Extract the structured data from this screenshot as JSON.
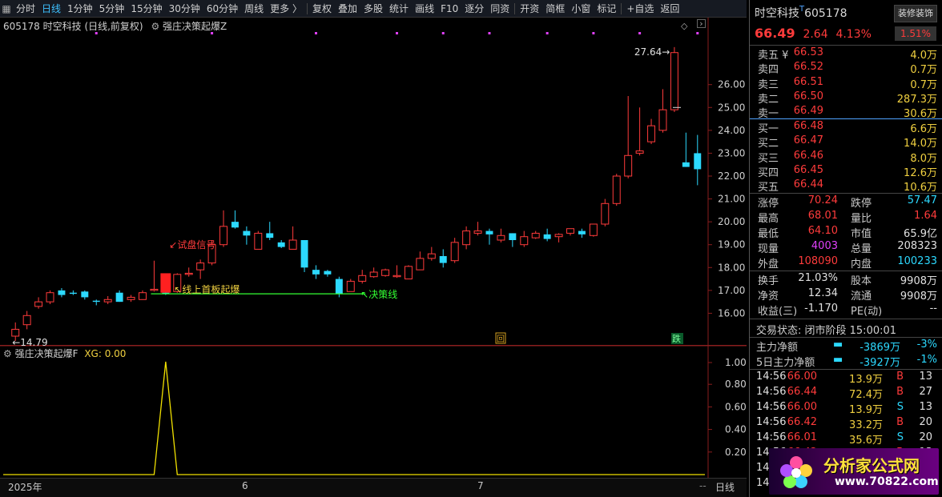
{
  "toolbar": {
    "items": [
      "分时",
      "日线",
      "1分钟",
      "5分钟",
      "15分钟",
      "30分钟",
      "60分钟",
      "周线",
      "更多 〉",
      "复权",
      "叠加",
      "多股",
      "统计",
      "画线",
      "F10",
      "逐分",
      "同资",
      "开资",
      "简框",
      "小窗",
      "标记",
      "+自选",
      "返回"
    ],
    "active": "日线"
  },
  "chart": {
    "header_title": "605178 时空科技 (日线,前复权)",
    "indicator_name": "强庄决策起爆Z",
    "y_ticks": [
      "26.00",
      "25.00",
      "24.00",
      "23.00",
      "22.00",
      "21.00",
      "20.00",
      "19.00",
      "18.00",
      "17.00",
      "16.00"
    ],
    "y_min": 15.0,
    "y_max": 28.3,
    "high_label": "27.64",
    "low_label": "14.79",
    "annotations": {
      "trial_pan": "试盘信号",
      "first_board": "线上首板起爆",
      "decision_line": "决策线"
    },
    "decision_line_price": 16.85,
    "markers": {
      "box_icon": "回",
      "fall_icon": "跌"
    },
    "colors": {
      "up": "#ff3b3b",
      "down": "#2cd9ff",
      "decision": "#33ff33",
      "annot_red": "#ff3b3b",
      "annot_yellow": "#f0d040",
      "purple_dot": "#e040fb"
    },
    "candles": [
      [
        15.0,
        15.6,
        14.79,
        15.3
      ],
      [
        15.5,
        16.1,
        15.3,
        15.9
      ],
      [
        16.3,
        16.7,
        16.2,
        16.5
      ],
      [
        16.5,
        17.0,
        16.4,
        16.9
      ],
      [
        17.0,
        17.1,
        16.7,
        16.8
      ],
      [
        16.9,
        17.0,
        16.8,
        16.85
      ],
      [
        16.95,
        17.0,
        16.6,
        16.7
      ],
      [
        16.55,
        16.6,
        16.35,
        16.5
      ],
      [
        16.5,
        16.75,
        16.4,
        16.6
      ],
      [
        16.9,
        17.0,
        16.5,
        16.5
      ],
      [
        16.6,
        16.8,
        16.5,
        16.7
      ],
      [
        16.6,
        17.0,
        16.6,
        16.9
      ],
      [
        17.0,
        18.3,
        16.95,
        17.05
      ],
      [
        16.9,
        17.0,
        16.8,
        16.85
      ],
      [
        16.95,
        17.75,
        16.9,
        17.7
      ],
      [
        17.7,
        18.0,
        17.6,
        17.75
      ],
      [
        17.9,
        18.35,
        17.5,
        18.2
      ],
      [
        18.2,
        19.2,
        18.1,
        19.0
      ],
      [
        19.0,
        20.5,
        18.9,
        19.8
      ],
      [
        20.0,
        20.5,
        19.7,
        19.75
      ],
      [
        19.6,
        19.8,
        19.0,
        19.4
      ],
      [
        18.8,
        19.6,
        18.8,
        19.5
      ],
      [
        19.5,
        20.0,
        19.2,
        19.3
      ],
      [
        19.1,
        19.2,
        18.85,
        18.9
      ],
      [
        18.8,
        19.8,
        18.8,
        19.2
      ],
      [
        19.2,
        19.2,
        17.8,
        18.0
      ],
      [
        17.9,
        18.1,
        17.5,
        17.7
      ],
      [
        17.85,
        17.9,
        17.6,
        17.7
      ],
      [
        17.5,
        17.6,
        16.7,
        16.85
      ],
      [
        16.95,
        17.5,
        16.95,
        17.4
      ],
      [
        17.4,
        17.9,
        17.3,
        17.65
      ],
      [
        17.6,
        18.0,
        17.55,
        17.8
      ],
      [
        17.65,
        17.95,
        17.6,
        17.9
      ],
      [
        17.6,
        18.1,
        17.55,
        17.65
      ],
      [
        17.5,
        18.1,
        17.5,
        18.05
      ],
      [
        17.9,
        18.7,
        17.9,
        18.4
      ],
      [
        18.4,
        18.9,
        18.3,
        18.6
      ],
      [
        18.5,
        18.8,
        18.0,
        18.2
      ],
      [
        18.3,
        19.3,
        18.2,
        19.1
      ],
      [
        19.0,
        19.8,
        18.8,
        19.6
      ],
      [
        19.5,
        20.0,
        19.4,
        19.6
      ],
      [
        19.6,
        19.7,
        19.0,
        19.45
      ],
      [
        19.2,
        19.7,
        19.1,
        19.4
      ],
      [
        19.5,
        19.5,
        18.9,
        19.2
      ],
      [
        19.0,
        19.6,
        18.9,
        19.35
      ],
      [
        19.3,
        19.6,
        19.25,
        19.5
      ],
      [
        19.45,
        19.7,
        19.15,
        19.25
      ],
      [
        19.35,
        19.5,
        19.1,
        19.45
      ],
      [
        19.5,
        19.7,
        19.4,
        19.7
      ],
      [
        19.6,
        19.7,
        19.3,
        19.45
      ],
      [
        19.4,
        19.9,
        19.35,
        19.9
      ],
      [
        19.9,
        21.0,
        19.8,
        20.8
      ],
      [
        20.8,
        22.1,
        20.7,
        22.0
      ],
      [
        22.0,
        25.5,
        21.9,
        22.9
      ],
      [
        23.0,
        25.0,
        22.9,
        23.1
      ],
      [
        23.5,
        24.5,
        23.4,
        24.2
      ],
      [
        24.0,
        25.8,
        23.9,
        24.9
      ],
      [
        24.9,
        27.64,
        24.8,
        27.4
      ],
      [
        22.6,
        23.9,
        22.4,
        22.4
      ],
      [
        23.0,
        23.8,
        21.6,
        22.3
      ]
    ],
    "date_labels": [
      "2025年",
      "6",
      "7"
    ]
  },
  "indicator": {
    "header": "强庄决策起爆F",
    "xg_label": "XG: 0.00",
    "y_ticks": [
      "1.00",
      "0.80",
      "0.60",
      "0.40",
      "0.20"
    ],
    "spike_index": 13
  },
  "side": {
    "name": "时空科技",
    "superscript": "T",
    "code": "605178",
    "decorate": "装修装饰",
    "price": "66.49",
    "change": "2.64",
    "change_pct": "4.13%",
    "badge": "1.51%",
    "asks": [
      {
        "label": "卖五 ¥",
        "price": "66.53",
        "vol": "4.0万"
      },
      {
        "label": "卖四",
        "price": "66.52",
        "vol": "0.7万"
      },
      {
        "label": "卖三",
        "price": "66.51",
        "vol": "0.7万"
      },
      {
        "label": "卖二",
        "price": "66.50",
        "vol": "287.3万"
      },
      {
        "label": "卖一",
        "price": "66.49",
        "vol": "30.6万"
      }
    ],
    "bids": [
      {
        "label": "买一",
        "price": "66.48",
        "vol": "6.6万"
      },
      {
        "label": "买二",
        "price": "66.47",
        "vol": "14.0万"
      },
      {
        "label": "买三",
        "price": "66.46",
        "vol": "8.0万"
      },
      {
        "label": "买四",
        "price": "66.45",
        "vol": "12.6万"
      },
      {
        "label": "买五",
        "price": "66.44",
        "vol": "10.6万"
      }
    ],
    "stats": [
      {
        "l1": "涨停",
        "v1": "70.24",
        "c1": "red",
        "l2": "跌停",
        "v2": "57.47",
        "c2": "cyan"
      },
      {
        "l1": "最高",
        "v1": "68.01",
        "c1": "red",
        "l2": "量比",
        "v2": "1.64",
        "c2": "red"
      },
      {
        "l1": "最低",
        "v1": "64.10",
        "c1": "red",
        "l2": "市值",
        "v2": "65.9亿",
        "c2": "white"
      },
      {
        "l1": "现量",
        "v1": "4003",
        "c1": "purple",
        "l2": "总量",
        "v2": "208323",
        "c2": "white"
      },
      {
        "l1": "外盘",
        "v1": "108090",
        "c1": "red",
        "l2": "内盘",
        "v2": "100233",
        "c2": "cyan"
      }
    ],
    "stats2": [
      {
        "l1": "换手",
        "v1": "21.03%",
        "l2": "股本",
        "v2": "9908万"
      },
      {
        "l1": "净资",
        "v1": "12.34",
        "l2": "流通",
        "v2": "9908万"
      },
      {
        "l1": "收益(三)",
        "v1": "-1.170",
        "l2": "PE(动)",
        "v2": "--"
      }
    ],
    "trade_state": "交易状态: 闭市阶段 15:00:01",
    "flow": [
      {
        "label": "主力净额",
        "val": "-3869万",
        "pct": "-3%"
      },
      {
        "label": "5日主力净额",
        "val": "-3927万",
        "pct": "-1%"
      }
    ],
    "ticks": [
      {
        "t": "14:56",
        "p": "66.00",
        "v": "13.9万",
        "s": "B",
        "n": "13"
      },
      {
        "t": "14:56",
        "p": "66.44",
        "v": "72.4万",
        "s": "B",
        "n": "27"
      },
      {
        "t": "14:56",
        "p": "66.00",
        "v": "13.9万",
        "s": "S",
        "n": "13"
      },
      {
        "t": "14:56",
        "p": "66.42",
        "v": "33.2万",
        "s": "B",
        "n": "20"
      },
      {
        "t": "14:56",
        "p": "66.01",
        "v": "35.6万",
        "s": "S",
        "n": "20"
      },
      {
        "t": "14:56",
        "p": "66.42",
        "v": "19.9万",
        "s": "B",
        "n": "13"
      },
      {
        "t": "14:5",
        "p": "",
        "v": "",
        "s": "",
        "n": ""
      },
      {
        "t": "14:5",
        "p": "",
        "v": "",
        "s": "",
        "n": ""
      }
    ]
  },
  "bottom": {
    "tab": "日线"
  },
  "logo": {
    "cn": "分析家公式网",
    "url": "www.70822.com"
  }
}
